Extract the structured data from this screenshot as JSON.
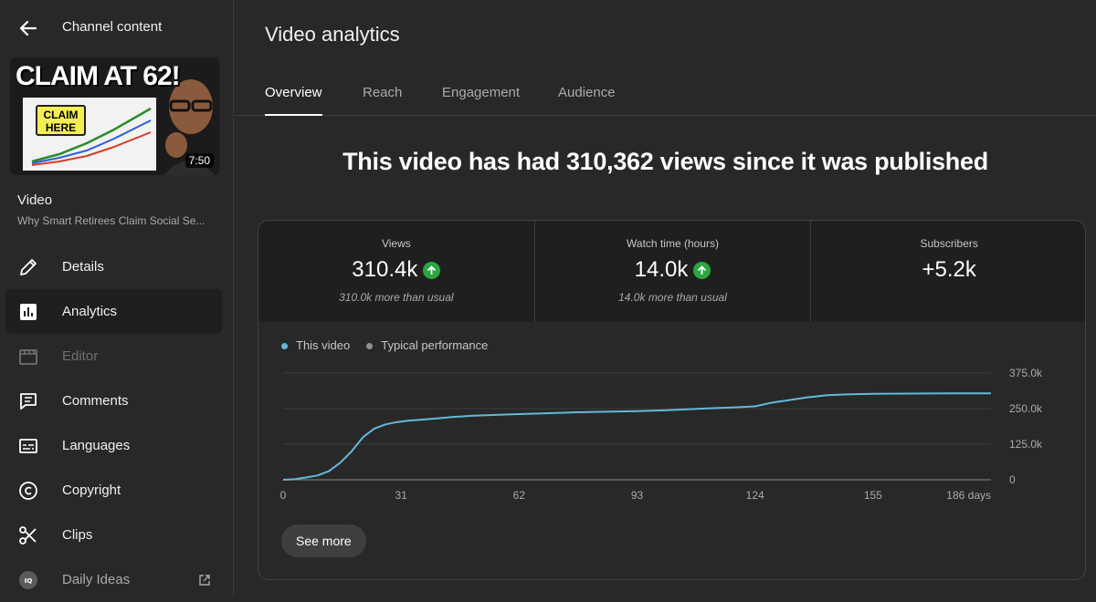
{
  "header": {
    "title": "Channel content"
  },
  "video": {
    "thumbnail_text": "CLAIM AT 62!",
    "thumbnail_badge": "CLAIM HERE",
    "duration": "7:50",
    "label": "Video",
    "title": "Why Smart Retirees Claim Social Se..."
  },
  "sidebar": {
    "items": [
      {
        "label": "Details",
        "icon": "pencil-icon"
      },
      {
        "label": "Analytics",
        "icon": "analytics-icon",
        "active": true
      },
      {
        "label": "Editor",
        "icon": "editor-icon",
        "disabled": true
      },
      {
        "label": "Comments",
        "icon": "comments-icon"
      },
      {
        "label": "Languages",
        "icon": "subtitles-icon"
      },
      {
        "label": "Copyright",
        "icon": "copyright-icon"
      },
      {
        "label": "Clips",
        "icon": "scissors-icon"
      },
      {
        "label": "Daily Ideas",
        "icon": "daily-ideas-icon",
        "external": true
      }
    ]
  },
  "main": {
    "title": "Video analytics",
    "tabs": [
      "Overview",
      "Reach",
      "Engagement",
      "Audience"
    ],
    "active_tab": "Overview",
    "headline": "This video has had 310,362 views since it was published",
    "metrics": [
      {
        "label": "Views",
        "value": "310.4k",
        "trend": "up",
        "sub": "310.0k more than usual"
      },
      {
        "label": "Watch time (hours)",
        "value": "14.0k",
        "trend": "up",
        "sub": "14.0k more than usual"
      },
      {
        "label": "Subscribers",
        "value": "+5.2k",
        "trend": "",
        "sub": ""
      }
    ],
    "see_more": "See more"
  },
  "colors": {
    "accent": "#65b8d9",
    "up": "#2ba640",
    "typical": "#909090"
  },
  "chart_data": {
    "type": "line",
    "legend": [
      "This video",
      "Typical performance"
    ],
    "x_ticks": [
      "0",
      "31",
      "62",
      "93",
      "124",
      "155",
      "186 days"
    ],
    "y_ticks": [
      "0",
      "125.0k",
      "250.0k",
      "375.0k"
    ],
    "xlim": [
      0,
      186
    ],
    "ylim": [
      0,
      375000
    ],
    "series": [
      {
        "name": "This video",
        "x": [
          0,
          3,
          6,
          9,
          12,
          15,
          18,
          21,
          24,
          27,
          30,
          33,
          36,
          40,
          45,
          50,
          60,
          70,
          80,
          93,
          100,
          110,
          120,
          124,
          128,
          133,
          138,
          143,
          148,
          155,
          165,
          175,
          186
        ],
        "y": [
          0,
          2000,
          8000,
          15000,
          30000,
          60000,
          100000,
          150000,
          180000,
          195000,
          203000,
          208000,
          211000,
          215000,
          221000,
          225000,
          230000,
          234000,
          238000,
          241000,
          244000,
          250000,
          255000,
          258000,
          270000,
          280000,
          290000,
          297000,
          300000,
          302000,
          303000,
          304000,
          304000
        ]
      }
    ]
  }
}
